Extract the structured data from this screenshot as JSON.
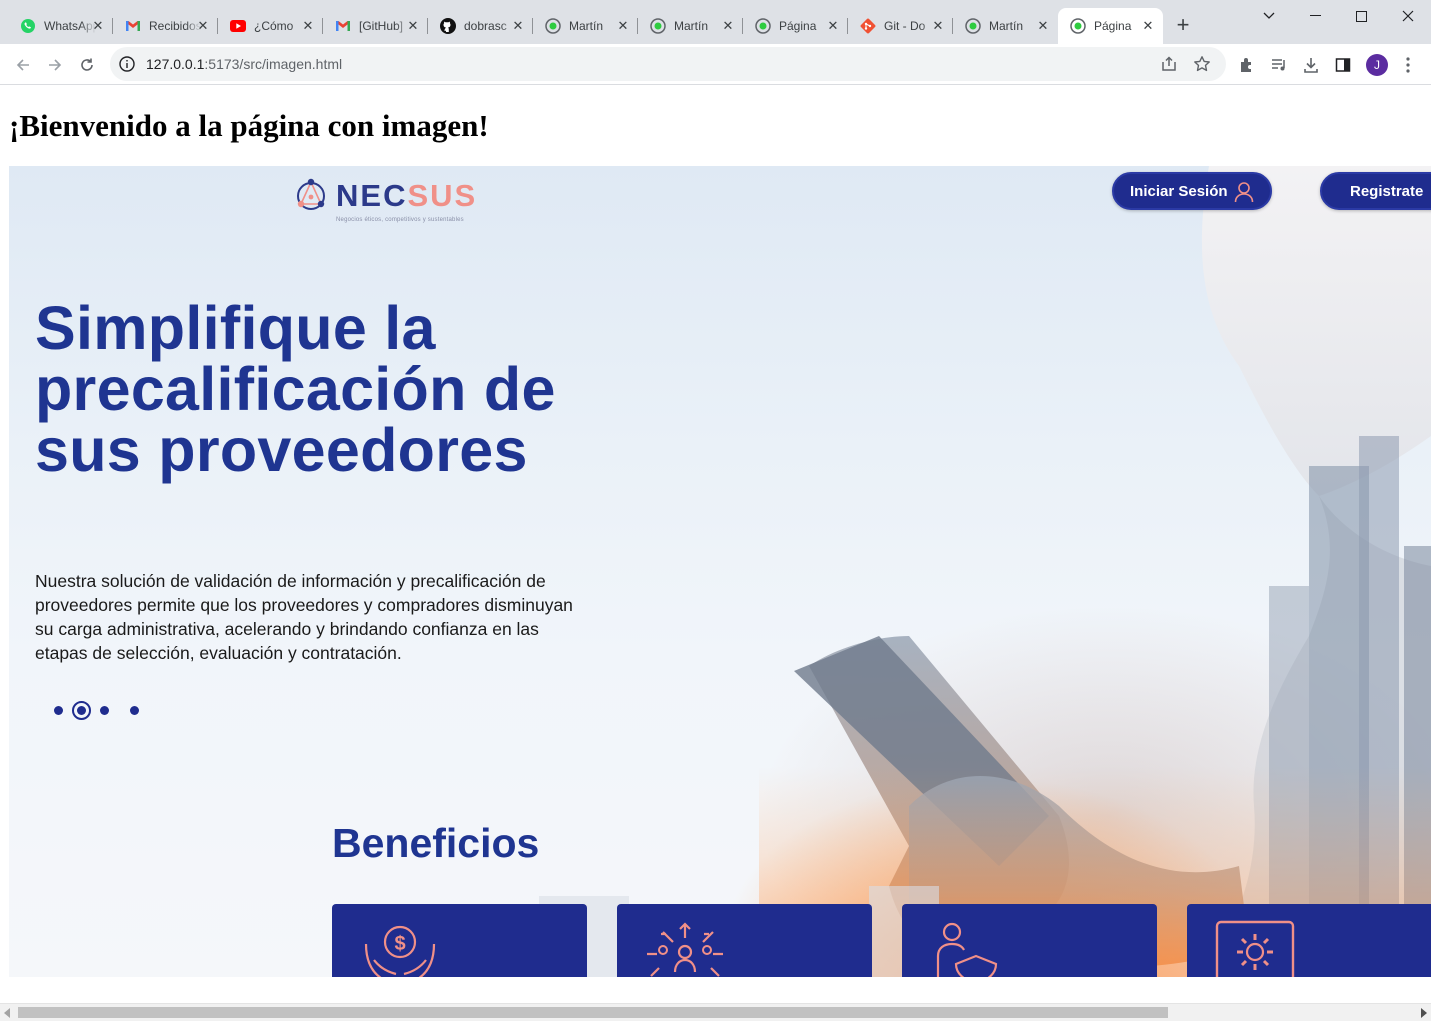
{
  "browser": {
    "tabs": [
      {
        "title": "WhatsApp",
        "icon": "whatsapp-icon",
        "active": false
      },
      {
        "title": "Recibidos",
        "icon": "gmail-icon",
        "active": false
      },
      {
        "title": "¿Cómo",
        "icon": "youtube-icon",
        "active": false
      },
      {
        "title": "[GitHub]",
        "icon": "gmail-icon",
        "active": false
      },
      {
        "title": "dobrasc",
        "icon": "github-icon",
        "active": false
      },
      {
        "title": "Martín",
        "icon": "site-icon",
        "active": false
      },
      {
        "title": "Martín",
        "icon": "site-icon",
        "active": false
      },
      {
        "title": "Página",
        "icon": "site-icon",
        "active": false
      },
      {
        "title": "Git - Do",
        "icon": "git-icon",
        "active": false
      },
      {
        "title": "Martín",
        "icon": "site-icon",
        "active": false
      },
      {
        "title": "Página",
        "icon": "site-icon",
        "active": true
      }
    ],
    "url_host": "127.0.0.1",
    "url_rest": ":5173/src/imagen.html",
    "avatar_letter": "J",
    "colors": {
      "tabbar": "#dee1e6",
      "omnibox": "#f1f3f4",
      "avatar": "#5b2ca0"
    }
  },
  "page": {
    "heading": "¡Bienvenido a la página con imagen!",
    "hero": {
      "logo": {
        "part1": "NEC",
        "part2": "SUS",
        "tagline": "Negocios éticos, competitivos y sustentables"
      },
      "login_label": "Iniciar Sesión",
      "register_label": "Registrate",
      "title": "Simplifique la precalificación de sus proveedores",
      "description": "Nuestra solución de validación de información y precalificación de proveedores permite que los proveedores y compradores disminuyan su carga administrativa, acelerando y brindando confianza en las etapas de selección, evaluación y contratación.",
      "carousel": {
        "count": 4,
        "active_index": 1
      },
      "benefits_title": "Beneficios",
      "benefit_cards": [
        {
          "icon": "money-hands-icon"
        },
        {
          "icon": "network-people-icon"
        },
        {
          "icon": "person-shield-icon"
        },
        {
          "icon": "settings-window-icon"
        }
      ]
    },
    "colors": {
      "primary": "#1f2c8e",
      "title": "#1f3591",
      "accent": "#f09088"
    }
  }
}
